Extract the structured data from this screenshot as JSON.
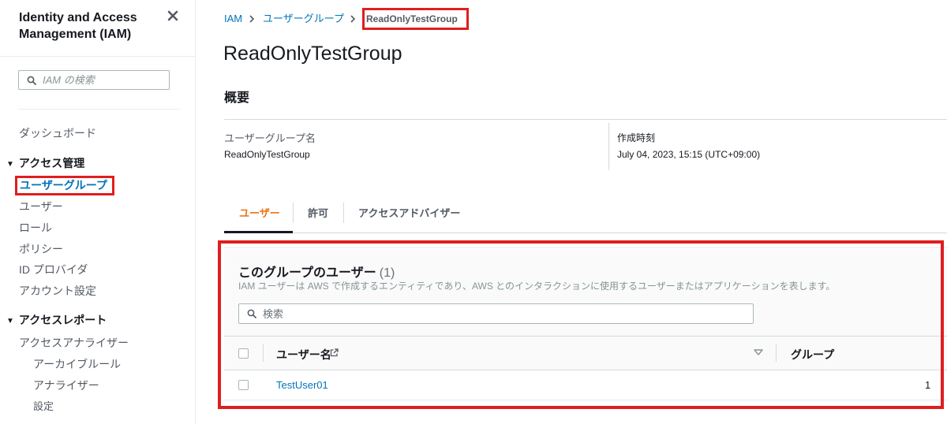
{
  "sidebar": {
    "title": "Identity and Access Management (IAM)",
    "search_placeholder": "IAM の検索",
    "dashboard": "ダッシュボード",
    "access_management": {
      "heading": "アクセス管理",
      "items": [
        "ユーザーグループ",
        "ユーザー",
        "ロール",
        "ポリシー",
        "ID プロバイダ",
        "アカウント設定"
      ],
      "active_index": 0
    },
    "access_reports": {
      "heading": "アクセスレポート",
      "items": [
        "アクセスアナライザー"
      ],
      "subitems": [
        "アーカイブルール",
        "アナライザー",
        "設定"
      ]
    }
  },
  "breadcrumb": {
    "items": [
      "IAM",
      "ユーザーグループ"
    ],
    "current": "ReadOnlyTestGroup"
  },
  "page": {
    "title": "ReadOnlyTestGroup",
    "overview_heading": "概要",
    "summary": {
      "group_name_label": "ユーザーグループ名",
      "group_name_value": "ReadOnlyTestGroup",
      "created_label": "作成時刻",
      "created_value": "July 04, 2023, 15:15 (UTC+09:00)"
    },
    "tabs": [
      "ユーザー",
      "許可",
      "アクセスアドバイザー"
    ],
    "active_tab": 0
  },
  "users_panel": {
    "heading": "このグループのユーザー",
    "count": "(1)",
    "description": "IAM ユーザーは AWS で作成するエンティティであり、AWS とのインタラクションに使用するユーザーまたはアプリケーションを表します。",
    "search_placeholder": "検索",
    "columns": [
      "ユーザー名",
      "グループ"
    ],
    "rows": [
      {
        "user_name": "TestUser01",
        "groups": "1"
      }
    ]
  },
  "colors": {
    "link": "#0073bb",
    "active_tab": "#ec7211",
    "highlight": "#e01e1e"
  }
}
